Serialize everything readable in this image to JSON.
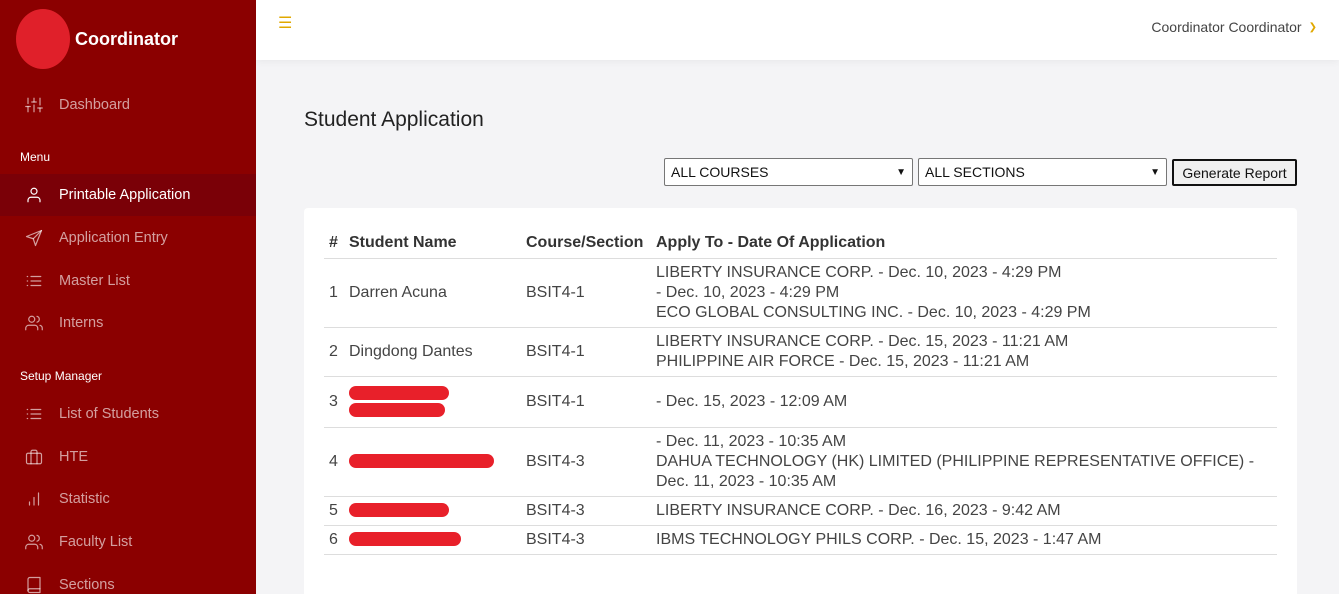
{
  "sidebar": {
    "brand": "Coordinator",
    "items": [
      {
        "label": "Dashboard",
        "icon": "sliders-icon"
      },
      {
        "heading": "Menu"
      },
      {
        "label": "Printable Application",
        "icon": "user-icon",
        "active": true
      },
      {
        "label": "Application Entry",
        "icon": "send-icon"
      },
      {
        "label": "Master List",
        "icon": "list-icon"
      },
      {
        "label": "Interns",
        "icon": "users-icon"
      },
      {
        "heading": "Setup Manager"
      },
      {
        "label": "List of Students",
        "icon": "list-icon"
      },
      {
        "label": "HTE",
        "icon": "briefcase-icon"
      },
      {
        "label": "Statistic",
        "icon": "bar-chart-icon"
      },
      {
        "label": "Faculty List",
        "icon": "users-icon"
      },
      {
        "label": "Sections",
        "icon": "book-icon"
      }
    ]
  },
  "topbar": {
    "menu_icon": "hamburger-icon",
    "user_name": "Coordinator Coordinator"
  },
  "main": {
    "title": "Student Application",
    "course_filter": "ALL COURSES",
    "section_filter": "ALL SECTIONS",
    "generate_label": "Generate Report",
    "columns": [
      "#",
      "Student Name",
      "Course/Section",
      "Apply To - Date Of Application"
    ],
    "rows": [
      {
        "num": "1",
        "name": "Darren Acuna",
        "course": "BSIT4-1",
        "apply": [
          "LIBERTY INSURANCE CORP. - Dec. 10, 2023 - 4:29 PM",
          "- Dec. 10, 2023 - 4:29 PM",
          "ECO GLOBAL CONSULTING INC. - Dec. 10, 2023 - 4:29 PM"
        ]
      },
      {
        "num": "2",
        "name": "Dingdong Dantes",
        "course": "BSIT4-1",
        "apply": [
          "LIBERTY INSURANCE CORP. - Dec. 15, 2023 - 11:21 AM",
          "PHILIPPINE AIR FORCE - Dec. 15, 2023 - 11:21 AM"
        ]
      },
      {
        "num": "3",
        "name": "",
        "redacted": true,
        "course": "BSIT4-1",
        "apply": [
          "- Dec. 15, 2023 - 12:09 AM"
        ]
      },
      {
        "num": "4",
        "name": "",
        "redacted": true,
        "course": "BSIT4-3",
        "apply": [
          "- Dec. 11, 2023 - 10:35 AM",
          "DAHUA TECHNOLOGY (HK) LIMITED (PHILIPPINE REPRESENTATIVE OFFICE) -",
          "Dec. 11, 2023 - 10:35 AM"
        ]
      },
      {
        "num": "5",
        "name": "",
        "redacted": true,
        "course": "BSIT4-3",
        "apply": [
          "LIBERTY INSURANCE CORP. - Dec. 16, 2023 - 9:42 AM"
        ]
      },
      {
        "num": "6",
        "name": "",
        "redacted": true,
        "course": "BSIT4-3",
        "apply": [
          "IBMS TECHNOLOGY PHILS CORP. - Dec. 15, 2023 - 1:47 AM"
        ]
      }
    ]
  },
  "colors": {
    "sidebar_bg": "#8b0000",
    "active_bg": "#7a0007",
    "accent": "#e0a800",
    "redaction": "#e8202a"
  }
}
